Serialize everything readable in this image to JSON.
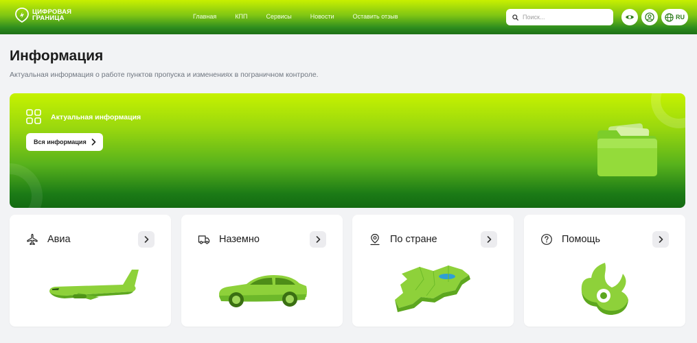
{
  "header": {
    "logo_line1": "ЦИФРОВАЯ",
    "logo_line2": "ГРАНИЦА",
    "nav": [
      "Главная",
      "КПП",
      "Сервисы",
      "Новости",
      "Оставить отзыв"
    ],
    "search_placeholder": "Поиск...",
    "language": "RU",
    "icons": [
      "search-icon",
      "eye-icon",
      "user-icon",
      "globe-icon"
    ]
  },
  "page": {
    "title": "Информация",
    "subtitle": "Актуальная информация о работе пунктов пропуска и изменениях в пограничном контроле."
  },
  "banner": {
    "title": "Актуальная информация",
    "button_label": "Вся информация"
  },
  "cards": [
    {
      "title": "Авиа",
      "icon": "plane-icon"
    },
    {
      "title": "Наземно",
      "icon": "truck-icon"
    },
    {
      "title": "По стране",
      "icon": "map-pin-icon"
    },
    {
      "title": "Помощь",
      "icon": "help-icon"
    }
  ],
  "colors": {
    "brand_green": "#2f8e1e",
    "lime": "#c8f000",
    "background": "#f2f3f5"
  }
}
